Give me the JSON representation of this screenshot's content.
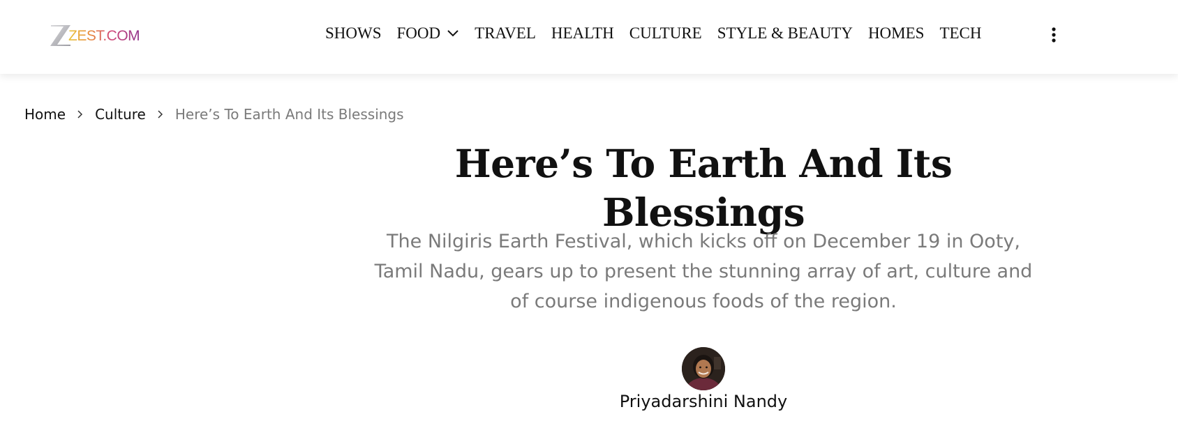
{
  "header": {
    "logo_text": "ZEST.COM",
    "nav": {
      "shows": "SHOWS",
      "food": "FOOD",
      "travel": "TRAVEL",
      "health": "HEALTH",
      "culture": "CULTURE",
      "style_beauty": "STYLE & BEAUTY",
      "homes": "HOMES",
      "tech": "TECH"
    },
    "icons": {
      "food_dropdown": "chevron-down-icon",
      "more": "more-vertical-icon"
    }
  },
  "breadcrumb": {
    "home": "Home",
    "section": "Culture",
    "current": "Here’s To Earth And Its Blessings",
    "separator_icon": "chevron-right-icon"
  },
  "article": {
    "title": "Here’s To Earth And Its Blessings",
    "summary": "The Nilgiris Earth Festival, which kicks off on December 19 in Ooty, Tamil Nadu, gears up to present the stunning array of art, culture and of course indigenous foods of the region.",
    "author_name": "Priyadarshini Nandy"
  },
  "colors": {
    "text_primary": "#111111",
    "text_muted": "#7a7a7a",
    "logo_gradient": [
      "#e8c53a",
      "#e88a3a",
      "#d14b7a",
      "#8e2f8a"
    ]
  }
}
